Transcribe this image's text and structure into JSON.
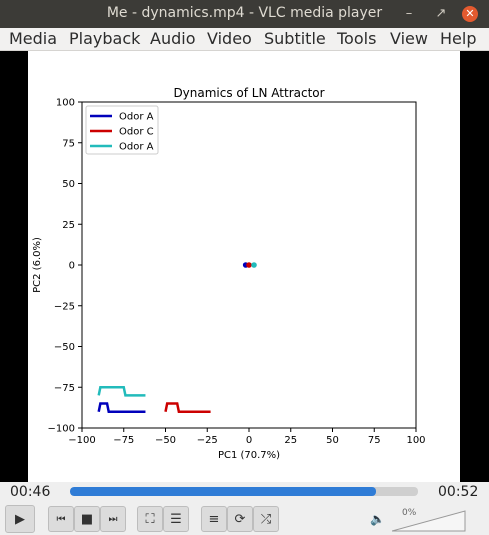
{
  "window": {
    "title": "Me - dynamics.mp4 - VLC media player"
  },
  "menu": {
    "items": [
      "Media",
      "Playback",
      "Audio",
      "Video",
      "Subtitle",
      "Tools",
      "View",
      "Help"
    ]
  },
  "player": {
    "elapsed": "00:46",
    "duration": "00:52",
    "progress_fraction": 0.88,
    "volume": "0%",
    "volume_fraction": 0.0,
    "icons": {
      "play": "play-icon",
      "previous": "skip-previous-icon",
      "stop": "stop-icon",
      "next": "skip-next-icon",
      "fullscreen": "fullscreen-icon",
      "extended_settings": "equalizer-icon",
      "playlist": "playlist-icon",
      "loop": "loop-icon",
      "shuffle": "shuffle-icon",
      "volume": "speaker-muted-icon"
    }
  },
  "chart_data": {
    "type": "line",
    "title": "Dynamics of LN Attractor",
    "xlabel": "PC1 (70.7%)",
    "ylabel": "PC2 (6.0%)",
    "xlim": [
      -100,
      100
    ],
    "ylim": [
      -100,
      100
    ],
    "xticks": [
      -100,
      -75,
      -50,
      -25,
      0,
      25,
      50,
      75,
      100
    ],
    "yticks": [
      100,
      75,
      50,
      25,
      0,
      -25,
      -50,
      -75,
      -100
    ],
    "grid": false,
    "legend_position": "top-left",
    "series": [
      {
        "name": "Odor A",
        "color": "#0000bb",
        "points": [
          [
            -90,
            -90
          ],
          [
            -89,
            -85
          ],
          [
            -85,
            -85
          ],
          [
            -84,
            -90
          ],
          [
            -62,
            -90
          ]
        ],
        "center": [
          -2,
          0
        ]
      },
      {
        "name": "Odor C",
        "color": "#cc0000",
        "points": [
          [
            -50,
            -90
          ],
          [
            -49,
            -85
          ],
          [
            -43,
            -85
          ],
          [
            -42,
            -90
          ],
          [
            -23,
            -90
          ]
        ],
        "center": [
          0,
          0
        ]
      },
      {
        "name": "Odor A",
        "color": "#22bbbb",
        "points": [
          [
            -90,
            -80
          ],
          [
            -89,
            -75
          ],
          [
            -75,
            -75
          ],
          [
            -74,
            -80
          ],
          [
            -62,
            -80
          ]
        ],
        "center": [
          3,
          0
        ]
      }
    ]
  }
}
